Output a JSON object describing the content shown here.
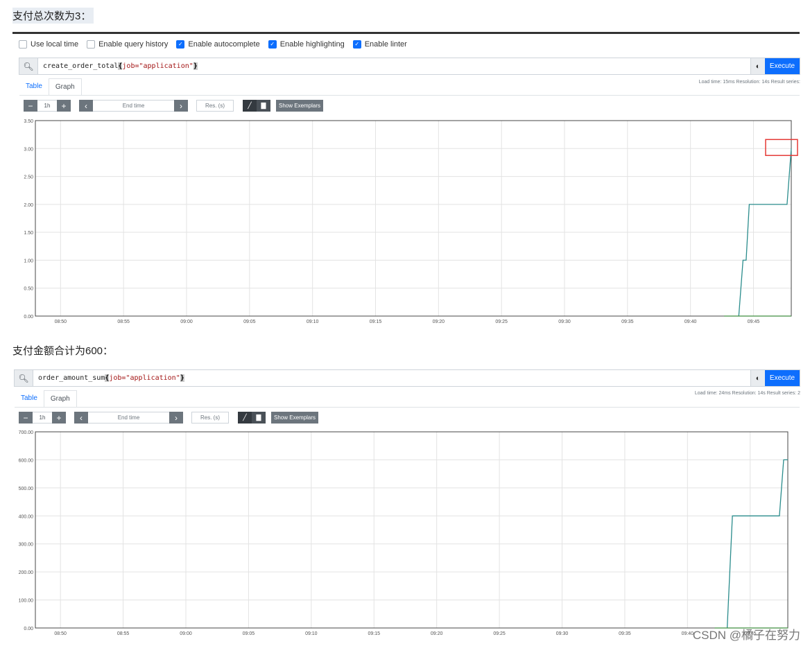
{
  "heading1": "支付总次数为3：",
  "heading2": "支付金额合计为600：",
  "options": [
    {
      "label": "Use local time",
      "checked": false
    },
    {
      "label": "Enable query history",
      "checked": false
    },
    {
      "label": "Enable autocomplete",
      "checked": true
    },
    {
      "label": "Enable highlighting",
      "checked": true
    },
    {
      "label": "Enable linter",
      "checked": true
    }
  ],
  "panel1": {
    "query_metric": "create_order_total",
    "query_label": "job=\"application\"",
    "execute_label": "Execute",
    "tab_table": "Table",
    "tab_graph": "Graph",
    "stats": "Load time: 15ms   Resolution: 14s   Result series:",
    "range": "1h",
    "end_time_placeholder": "End time",
    "res_placeholder": "Res. (s)",
    "exemplars_label": "Show Exemplars"
  },
  "panel2": {
    "query_metric": "order_amount_sum",
    "query_label": "job=\"application\"",
    "execute_label": "Execute",
    "tab_table": "Table",
    "tab_graph": "Graph",
    "stats": "Load time: 24ms   Resolution: 14s   Result series: 2",
    "range": "1h",
    "end_time_placeholder": "End time",
    "res_placeholder": "Res. (s)",
    "exemplars_label": "Show Exemplars"
  },
  "watermark": "CSDN @橘子在努力",
  "colors": {
    "series_teal": "#2a8c8c",
    "series_green": "#3e8e3e",
    "highlight_box": "#e53935",
    "execute": "#0d6efd"
  },
  "chart_data": [
    {
      "type": "line",
      "ylim": [
        0,
        3.5
      ],
      "ytick_labels": [
        "0.00",
        "0.50",
        "1.00",
        "1.50",
        "2.00",
        "2.50",
        "3.00",
        "3.50"
      ],
      "xtick_labels": [
        "08:50",
        "08:55",
        "09:00",
        "09:05",
        "09:10",
        "09:15",
        "09:20",
        "09:25",
        "09:30",
        "09:35",
        "09:40",
        "09:45"
      ],
      "x_range_minutes": [
        "08:48",
        "09:48"
      ],
      "series": [
        {
          "points": [
            [
              "09:43:50",
              0
            ],
            [
              "09:44:10",
              1
            ],
            [
              "09:44:25",
              1
            ],
            [
              "09:44:40",
              2
            ],
            [
              "09:47:40",
              2
            ],
            [
              "09:48:00",
              3
            ]
          ]
        },
        {
          "points": [
            [
              "09:42:40",
              0
            ],
            [
              "09:48:00",
              0
            ]
          ]
        }
      ],
      "annotation": {
        "type": "highlight-box",
        "x": "09:48",
        "y": 3.0
      }
    },
    {
      "type": "line",
      "ylim": [
        0,
        700
      ],
      "ytick_labels": [
        "0.00",
        "100.00",
        "200.00",
        "300.00",
        "400.00",
        "500.00",
        "600.00",
        "700.00"
      ],
      "xtick_labels": [
        "08:50",
        "08:55",
        "09:00",
        "09:05",
        "09:10",
        "09:15",
        "09:20",
        "09:25",
        "09:30",
        "09:35",
        "09:40",
        "09:45"
      ],
      "x_range_minutes": [
        "08:48",
        "09:48"
      ],
      "series": [
        {
          "points": [
            [
              "09:43:10",
              0
            ],
            [
              "09:43:35",
              400
            ],
            [
              "09:47:20",
              400
            ],
            [
              "09:47:40",
              600
            ],
            [
              "09:48:00",
              600
            ]
          ]
        },
        {
          "points": [
            [
              "09:42:10",
              0
            ],
            [
              "09:48:00",
              0
            ]
          ]
        }
      ]
    }
  ]
}
